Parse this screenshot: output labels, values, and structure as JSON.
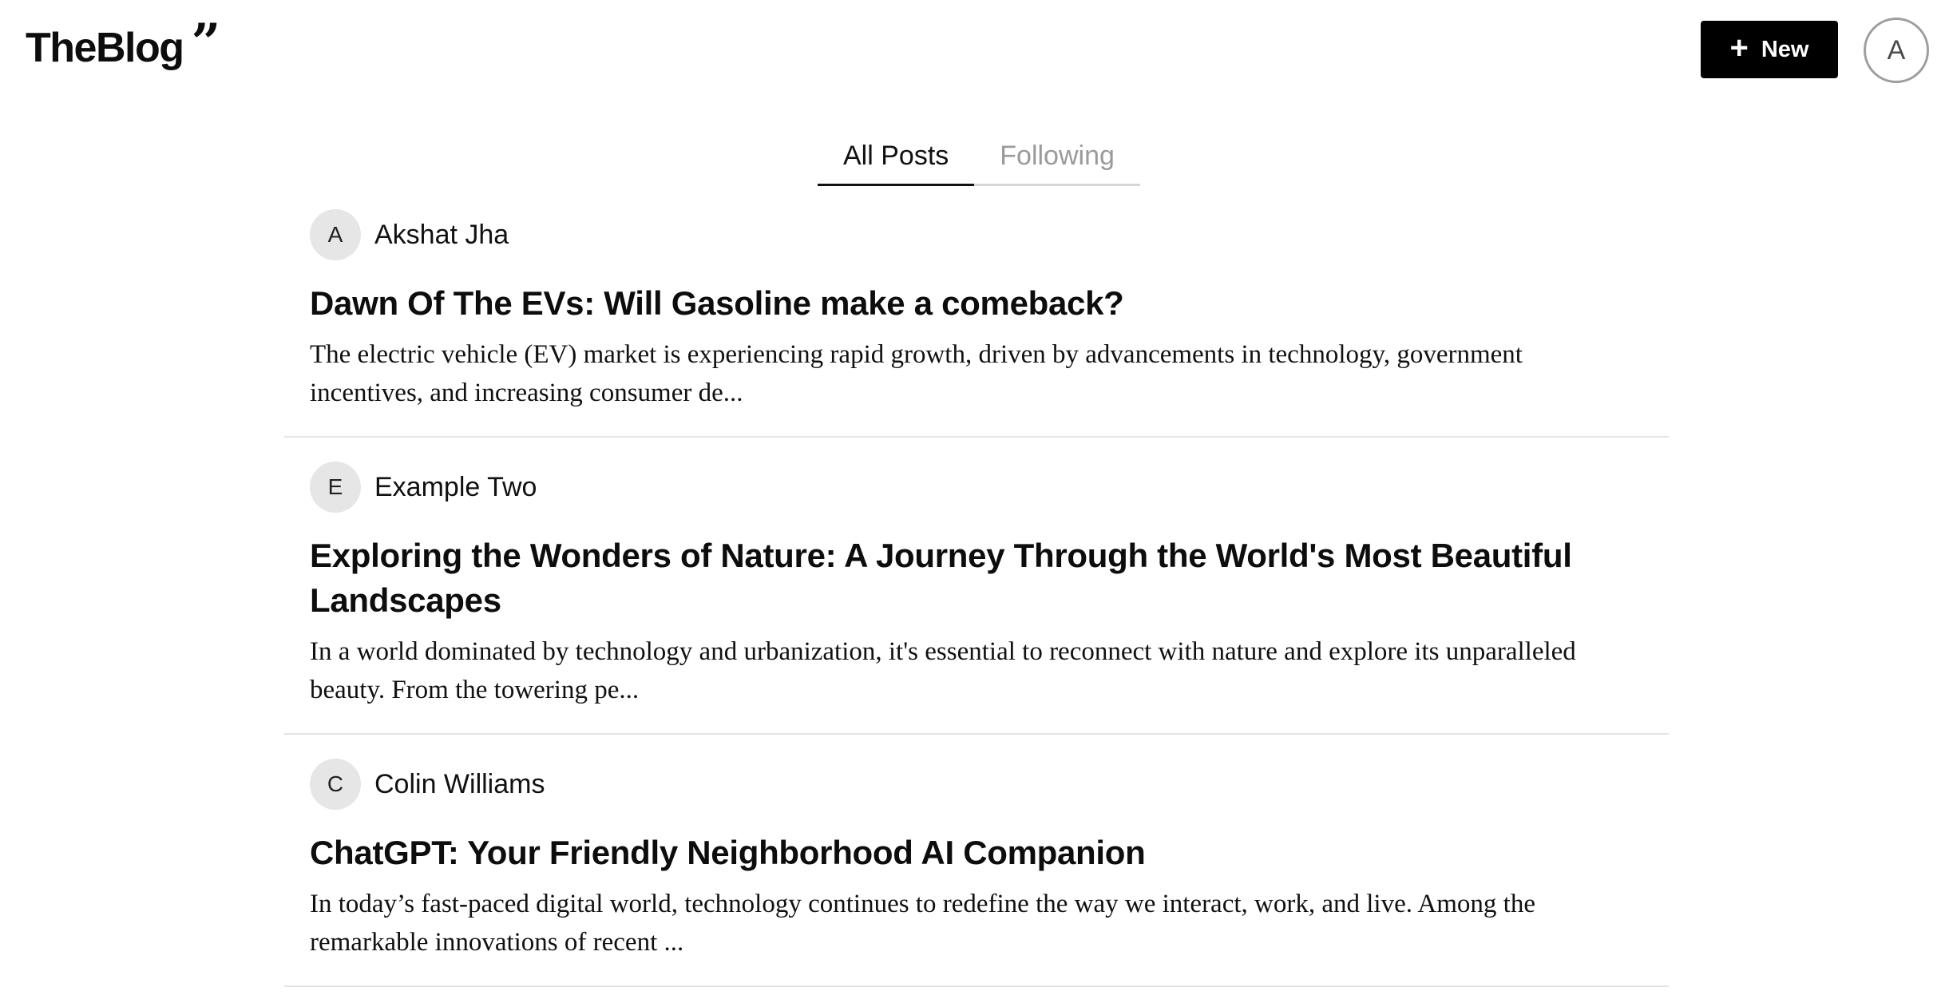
{
  "app": {
    "logo_text": "TheBlog",
    "logo_mark": "”"
  },
  "header": {
    "new_button_label": "New",
    "new_button_icon": "plus-icon",
    "user_avatar_initial": "A"
  },
  "tabs": [
    {
      "label": "All Posts",
      "active": true
    },
    {
      "label": "Following",
      "active": false
    }
  ],
  "posts": [
    {
      "author_initial": "A",
      "author_name": "Akshat Jha",
      "title": "Dawn Of The EVs: Will Gasoline make a comeback?",
      "excerpt": "The electric vehicle (EV) market is experiencing rapid growth, driven by advancements in technology, government incentives, and increasing consumer de..."
    },
    {
      "author_initial": "E",
      "author_name": "Example Two",
      "title": "Exploring the Wonders of Nature: A Journey Through the World's Most Beautiful Landscapes",
      "excerpt": "In a world dominated by technology and urbanization, it's essential to reconnect with nature and explore its unparalleled beauty. From the towering pe..."
    },
    {
      "author_initial": "C",
      "author_name": "Colin Williams",
      "title": "ChatGPT: Your Friendly Neighborhood AI Companion",
      "excerpt": "In today’s fast-paced digital world, technology continues to redefine the way we interact, work, and live. Among the remarkable innovations of recent ..."
    }
  ]
}
